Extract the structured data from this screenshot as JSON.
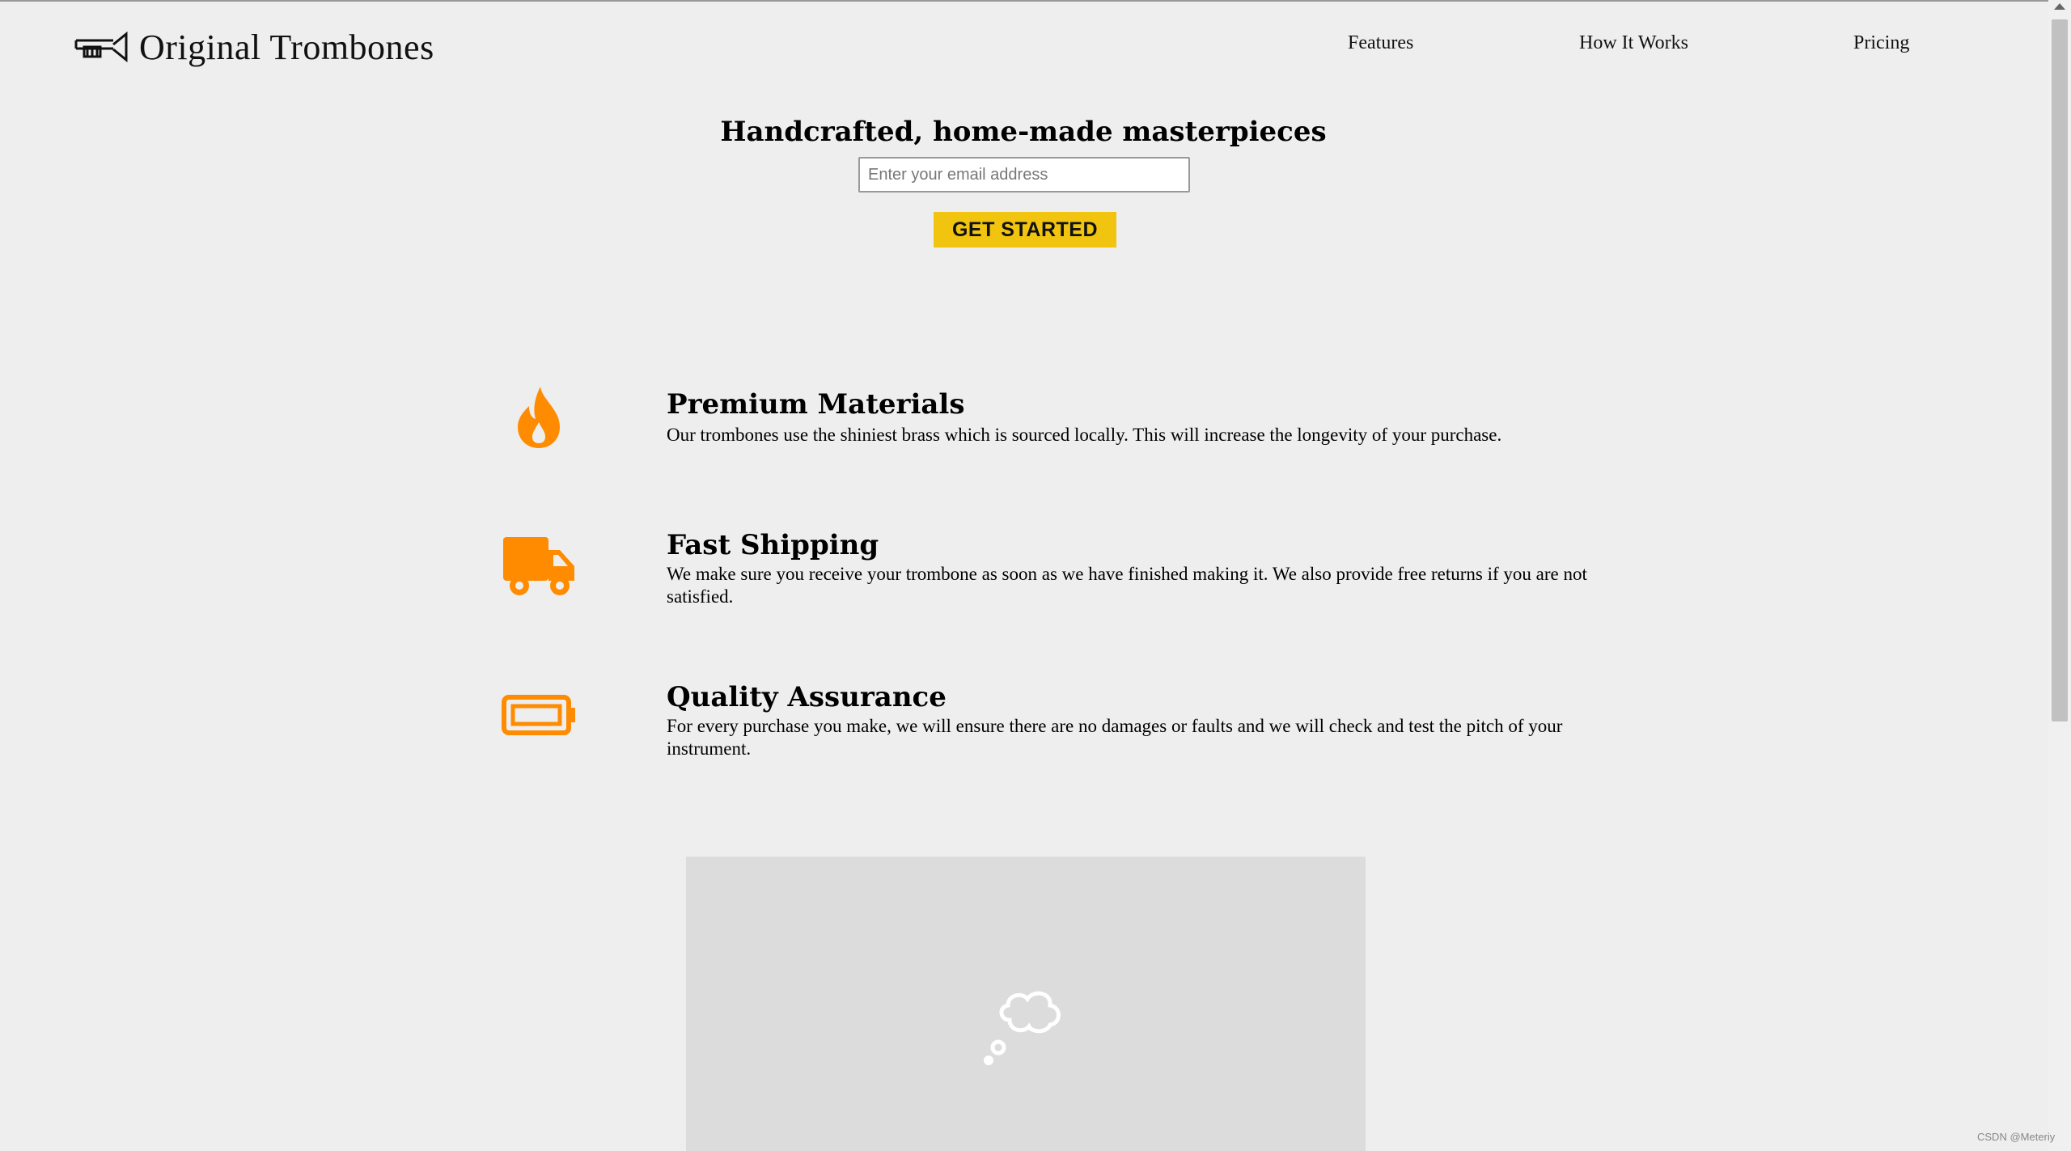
{
  "header": {
    "logo_text": "Original Trombones",
    "logo_icon": "trombone-icon",
    "nav": [
      {
        "label": "Features"
      },
      {
        "label": "How It Works"
      },
      {
        "label": "Pricing"
      }
    ]
  },
  "hero": {
    "title": "Handcrafted, home-made masterpieces",
    "email_placeholder": "Enter your email address",
    "button_label": "GET STARTED"
  },
  "features": [
    {
      "icon": "flame-icon",
      "title": "Premium Materials",
      "text": "Our trombones use the shiniest brass which is sourced locally. This will increase the longevity of your purchase."
    },
    {
      "icon": "truck-icon",
      "title": "Fast Shipping",
      "text": "We make sure you receive your trombone as soon as we have finished making it. We also provide free returns if you are not satisfied."
    },
    {
      "icon": "battery-icon",
      "title": "Quality Assurance",
      "text": "For every purchase you make, we will ensure there are no damages or faults and we will check and test the pitch of your instrument."
    }
  ],
  "video": {
    "icon": "thought-bubble-icon"
  },
  "watermark": "CSDN @Meteriy",
  "colors": {
    "accent": "#f1c40f",
    "icon_orange": "#ff8c00",
    "background": "#eeeeee"
  }
}
